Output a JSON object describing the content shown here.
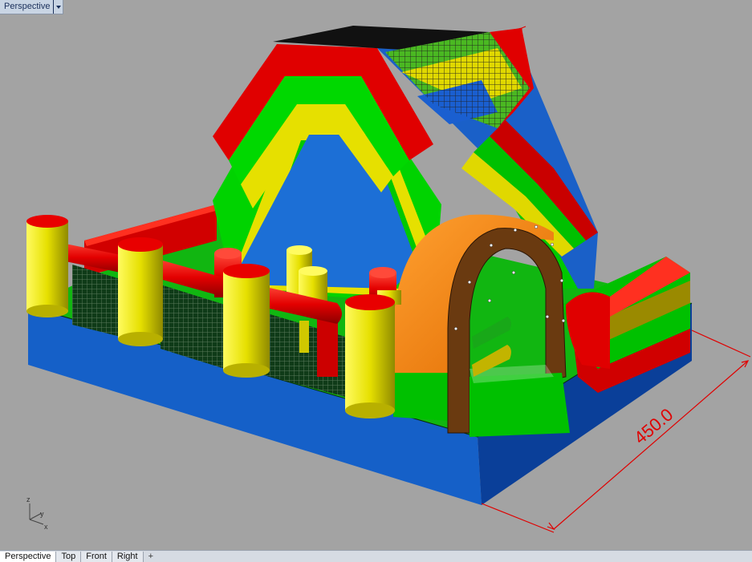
{
  "viewport": {
    "title": "Perspective",
    "dimension_value": "450.0",
    "axis_labels": {
      "z": "z",
      "y": "y",
      "x": "x"
    }
  },
  "tabs": [
    {
      "label": "Perspective",
      "active": true
    },
    {
      "label": "Top",
      "active": false
    },
    {
      "label": "Front",
      "active": false
    },
    {
      "label": "Right",
      "active": false
    }
  ],
  "add_tab_symbol": "+",
  "colors": {
    "background": "#a3a3a3",
    "model_blue": "#1f6fd6",
    "model_red": "#e30000",
    "model_green": "#00dd00",
    "model_yellow": "#e6e000",
    "model_orange": "#f08000",
    "model_brown": "#6a3a10",
    "dimension_red": "#e00000"
  }
}
